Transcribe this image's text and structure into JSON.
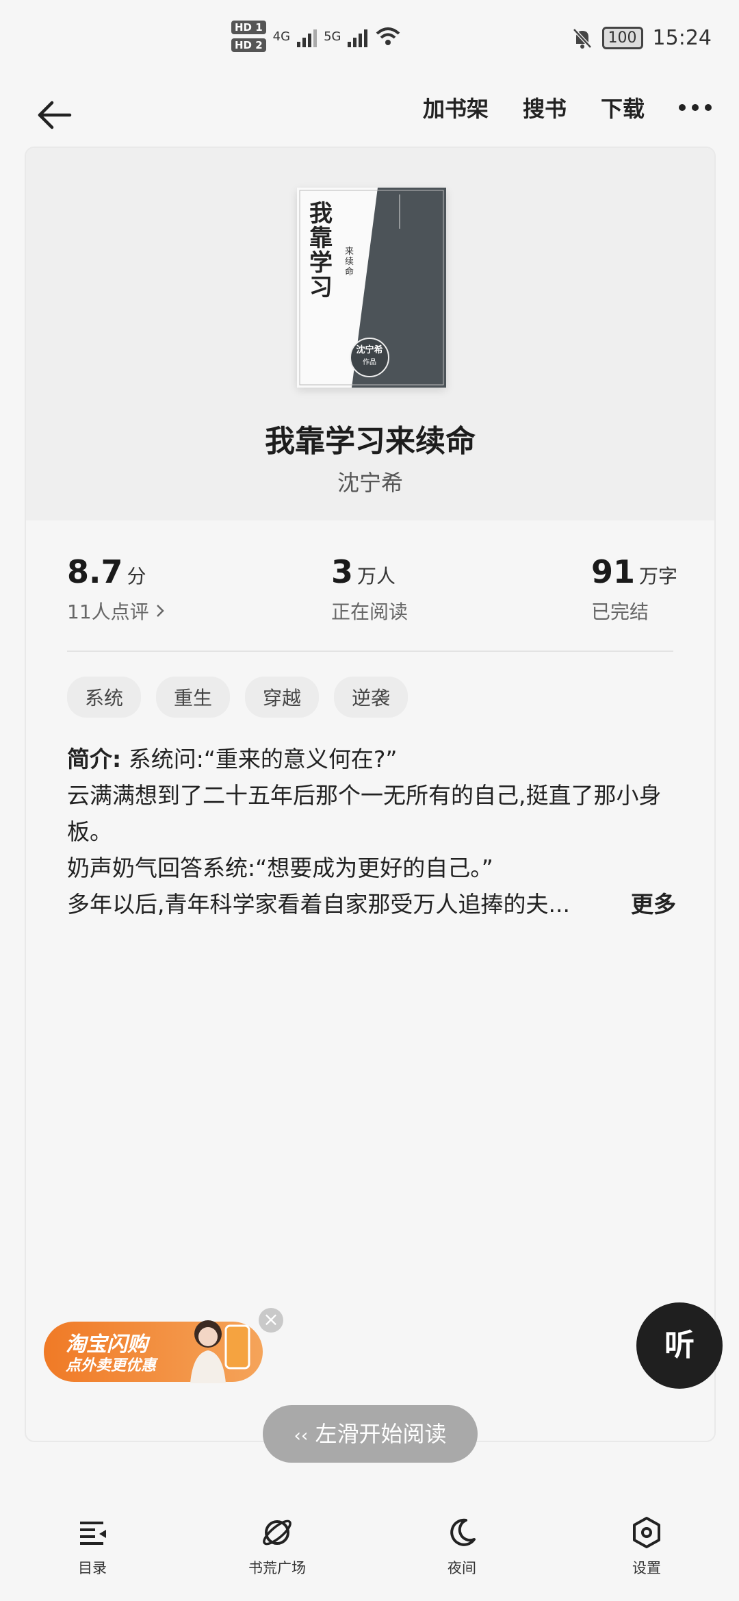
{
  "status_bar": {
    "hd1": "HD 1",
    "hd2": "HD 2",
    "net1": "4G",
    "net2": "5G",
    "battery": "100",
    "time": "15:24"
  },
  "nav": {
    "add_shelf": "加书架",
    "search": "搜书",
    "download": "下载"
  },
  "book": {
    "title": "我靠学习来续命",
    "author": "沈宁希",
    "cover_title": "我靠学习",
    "cover_sub": "来续命",
    "cover_author": "沈宁希",
    "cover_badge": "作品"
  },
  "stats": {
    "rating_value": "8.7",
    "rating_unit": "分",
    "rating_sub": "11人点评",
    "readers_value": "3",
    "readers_unit": "万人",
    "readers_sub": "正在阅读",
    "words_value": "91",
    "words_unit": "万字",
    "words_sub": "已完结"
  },
  "tags": [
    "系统",
    "重生",
    "穿越",
    "逆袭"
  ],
  "intro": {
    "label": "简介:",
    "line1": "系统问:“重来的意义何在?”",
    "line2": "云满满想到了二十五年后那个一无所有的自己,挺直了那小身板。",
    "line3": "奶声奶气回答系统:“想要成为更好的自己。”",
    "line4": "多年以后,青年科学家看着自家那受万人追捧的夫...",
    "more": "更多"
  },
  "ad": {
    "title": "淘宝闪购",
    "subtitle": "点外卖更优惠"
  },
  "listen_label": "听",
  "swipe_label": "左滑开始阅读",
  "bottom": {
    "toc": "目录",
    "square": "书荒广场",
    "night": "夜间",
    "settings": "设置"
  }
}
